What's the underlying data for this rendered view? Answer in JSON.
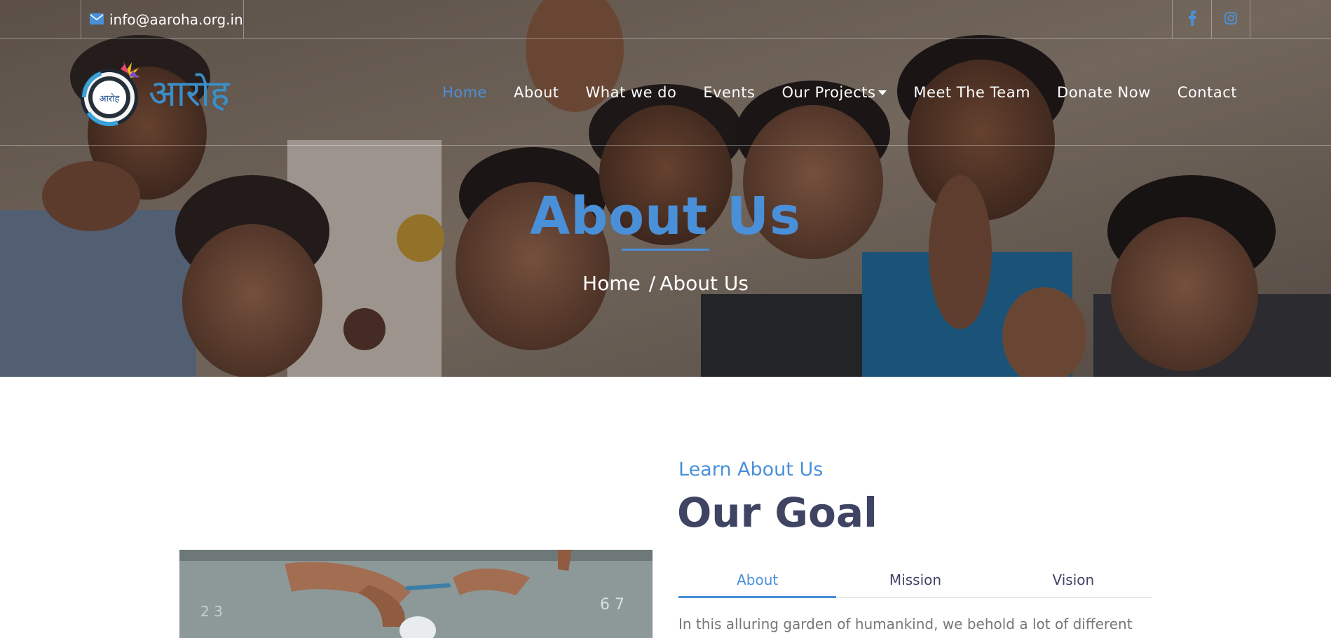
{
  "topbar": {
    "email": "info@aaroha.org.in",
    "email_icon": "envelope-icon",
    "social": [
      {
        "name": "facebook",
        "icon": "facebook-icon"
      },
      {
        "name": "instagram",
        "icon": "instagram-icon"
      }
    ]
  },
  "logo": {
    "text": "आरोह",
    "badge_text": "आरोह"
  },
  "nav": {
    "items": [
      {
        "label": "Home",
        "active": true
      },
      {
        "label": "About",
        "active": false
      },
      {
        "label": "What we do",
        "active": false
      },
      {
        "label": "Events",
        "active": false
      },
      {
        "label": "Our Projects",
        "active": false,
        "dropdown": true
      },
      {
        "label": "Meet The Team",
        "active": false
      },
      {
        "label": "Donate Now",
        "active": false
      },
      {
        "label": "Contact",
        "active": false
      }
    ]
  },
  "hero": {
    "title": "About Us",
    "breadcrumb_home": "Home",
    "breadcrumb_sep": "/",
    "breadcrumb_current": "About Us"
  },
  "about": {
    "eyebrow": "Learn About Us",
    "heading": "Our Goal",
    "tabs": [
      {
        "label": "About",
        "active": true
      },
      {
        "label": "Mission",
        "active": false
      },
      {
        "label": "Vision",
        "active": false
      }
    ],
    "text": "In this alluring garden of humankind, we behold a lot of different plants"
  },
  "colors": {
    "accent": "#4a90d9",
    "heading": "#3f4463",
    "body_text": "#777777",
    "white": "#ffffff"
  }
}
